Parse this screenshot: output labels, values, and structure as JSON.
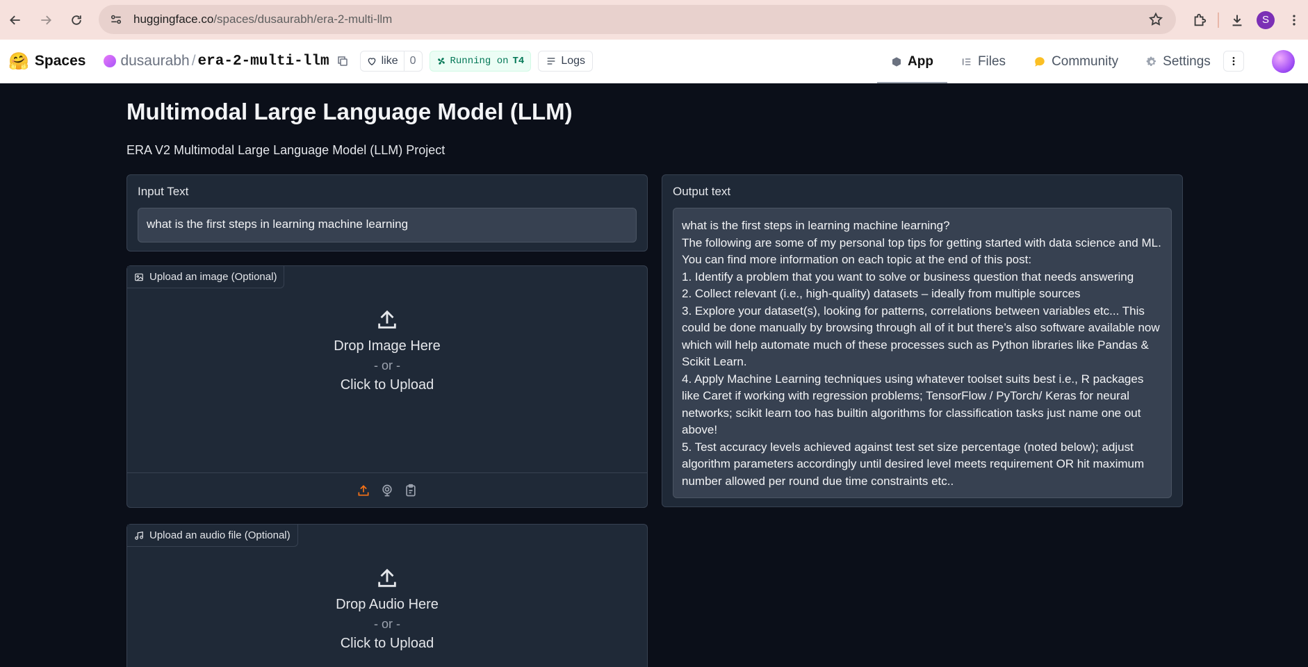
{
  "browser": {
    "url_host": "huggingface.co",
    "url_path": "/spaces/dusaurabh/era-2-multi-llm",
    "profile_initial": "S"
  },
  "header": {
    "logo_emoji": "🤗",
    "spaces_label": "Spaces",
    "owner": "dusaurabh",
    "separator": "/",
    "space_name": "era-2-multi-llm",
    "like_label": "like",
    "like_count": "0",
    "running_label": "Running on",
    "hardware": "T4",
    "logs_label": "Logs",
    "tabs": [
      {
        "label": "App",
        "icon": "app-icon",
        "active": true
      },
      {
        "label": "Files",
        "icon": "files-icon",
        "active": false
      },
      {
        "label": "Community",
        "icon": "community-icon",
        "active": false
      },
      {
        "label": "Settings",
        "icon": "gear-icon",
        "active": false
      }
    ]
  },
  "app": {
    "title": "Multimodal Large Language Model (LLM)",
    "description": "ERA V2 Multimodal Large Language Model (LLM) Project",
    "input": {
      "label": "Input Text",
      "value": "what is the first steps in learning machine learning"
    },
    "output": {
      "label": "Output text",
      "value": "what is the first steps in learning machine learning?\nThe following are some of my personal top tips for getting started with data science and ML. You can find more information on each topic at the end of this post:\n1. Identify a problem that you want to solve or business question that needs answering\n2. Collect relevant (i.e., high-quality) datasets – ideally from multiple sources\n3. Explore your dataset(s), looking for patterns, correlations between variables etc... This could be done manually by browsing through all of it but there’s also software available now which will help automate much of these processes such as Python libraries like Pandas & Scikit Learn.\n4. Apply Machine Learning techniques using whatever toolset suits best i.e., R packages like Caret if working with regression problems; TensorFlow / PyTorch/ Keras for neural networks; scikit learn too has builtin algorithms for classification tasks just name one out above!\n5. Test accuracy levels achieved against test set size percentage (noted below); adjust algorithm parameters accordingly until desired level meets requirement OR hit maximum number allowed per round due time constraints etc.."
    },
    "image_upload": {
      "label": "Upload an image (Optional)",
      "drop_text": "Drop Image Here",
      "or_text": "- or -",
      "click_text": "Click to Upload"
    },
    "audio_upload": {
      "label": "Upload an audio file (Optional)",
      "drop_text": "Drop Audio Here",
      "or_text": "- or -",
      "click_text": "Click to Upload"
    }
  },
  "colors": {
    "accent": "#f97316",
    "background": "#0b0f19",
    "panel": "#1f2937"
  }
}
